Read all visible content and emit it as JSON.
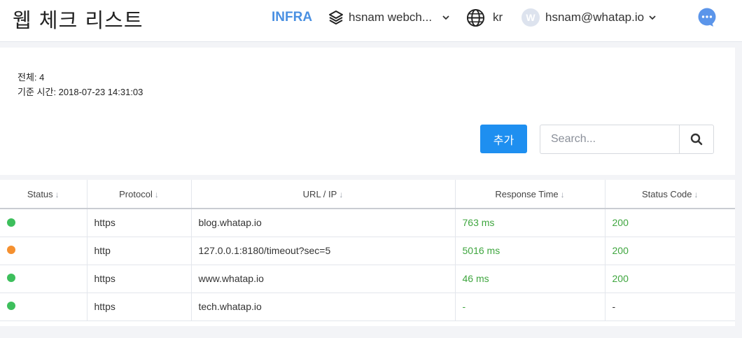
{
  "header": {
    "title": "웹 체크 리스트",
    "infra_label": "INFRA",
    "project_label": "hsnam webch...",
    "lang_label": "kr",
    "avatar_initial": "W",
    "user_label": "hsnam@whatap.io"
  },
  "summary": {
    "total_line": "전체: 4",
    "time_line": "기준 시간: 2018-07-23 14:31:03"
  },
  "toolbar": {
    "add_label": "추가",
    "search_placeholder": "Search...",
    "search_value": ""
  },
  "table": {
    "columns": [
      {
        "label": "Status",
        "arrow": "↓"
      },
      {
        "label": "Protocol",
        "arrow": "↓"
      },
      {
        "label": "URL / IP",
        "arrow": "↓"
      },
      {
        "label": "Response Time",
        "arrow": "↓"
      },
      {
        "label": "Status Code",
        "arrow": "↓"
      }
    ],
    "rows": [
      {
        "status_color": "#3dbf5c",
        "protocol": "https",
        "url": "blog.whatap.io",
        "response_time": "763 ms",
        "status_code": "200"
      },
      {
        "status_color": "#f5902f",
        "protocol": "http",
        "url": "127.0.0.1:8180/timeout?sec=5",
        "response_time": "5016 ms",
        "status_code": "200"
      },
      {
        "status_color": "#3dbf5c",
        "protocol": "https",
        "url": "www.whatap.io",
        "response_time": "46 ms",
        "status_code": "200"
      },
      {
        "status_color": "#3dbf5c",
        "protocol": "https",
        "url": "tech.whatap.io",
        "response_time": "-",
        "status_code": "-"
      }
    ]
  },
  "colors": {
    "accent": "#1e8ff0",
    "infra": "#4a90e2",
    "ok_text": "#3fa63f"
  }
}
